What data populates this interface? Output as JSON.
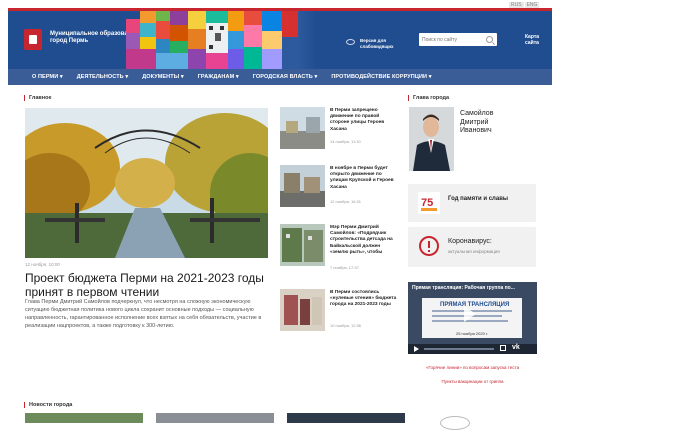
{
  "lang": {
    "ru": "RUS",
    "en": "ENG"
  },
  "header": {
    "logo_text": "Муниципальное образование город Пермь",
    "accessibility_link": "Версия для слабовидящих",
    "search_placeholder": "Поиск по сайту",
    "sites_link": "Карта сайта"
  },
  "nav": {
    "items": [
      "О ПЕРМИ ▾",
      "ДЕЯТЕЛЬНОСТЬ ▾",
      "ДОКУМЕНТЫ ▾",
      "ГРАЖДАНАМ ▾",
      "ГОРОДСКАЯ ВЛАСТЬ ▾",
      "ПРОТИВОДЕЙСТВИЕ КОРРУПЦИИ ▾"
    ]
  },
  "main": {
    "section_label": "Главное",
    "hero": {
      "date": "12 ноября, 10:00",
      "title": "Проект бюджета Перми на 2021-2023 годы принят в первом чтении",
      "description": "Глава Перми Дмитрий Самойлов подчеркнул, что несмотря на сложную экономическую ситуацию бюджетная политика нового цикла сохранит основные подходы — социальную направленность, гарантированное исполнение всех взятых на себя обязательств, участие в реализации нацпроектов, а также подготовку к 300-летию."
    },
    "news": [
      {
        "title": "В Перми запрещено движение по правой стороне улицы Героев Хасана",
        "date": "14 ноября, 11:30"
      },
      {
        "title": "В ноябре в Перми будет открыто движение по улицам Крупской и Героев Хасана",
        "date": "12 ноября, 16:31"
      },
      {
        "title": "Мэр Перми Дмитрий Самойлов: «Подрядчик строительства детсада на Байкальской должен «землю рыть», чтобы",
        "date": "7 ноября, 17:37"
      },
      {
        "title": "В Перми состоялись «нулевые чтения» бюджета города на 2021-2023 годы",
        "date": "10 ноября, 12:36"
      }
    ]
  },
  "sidebar": {
    "section_label": "Глава города",
    "mayor_name": "Самойлов Дмитрий Иванович",
    "memory_card": {
      "title": "Год памяти и славы",
      "badge": "75"
    },
    "covid_card": {
      "title": "Коронавирус:",
      "subtitle": "актуальная информация"
    },
    "video": {
      "title": "Прямая трансляция: Рабочая группа по...",
      "overlay": "ПРЯМАЯ ТРАНСЛЯЦИЯ",
      "date": "25 ноября 2020 г."
    },
    "hotline_link": "«Горячие линии» по вопросам запуска теста",
    "vaccination_link": "Пункты вакцинации от гриппа"
  },
  "bottom": {
    "section_label": "Новости города"
  },
  "colors": {
    "header_blue": "#1f4d8f",
    "nav_blue": "#3a5d98",
    "accent_red": "#c8262f"
  }
}
